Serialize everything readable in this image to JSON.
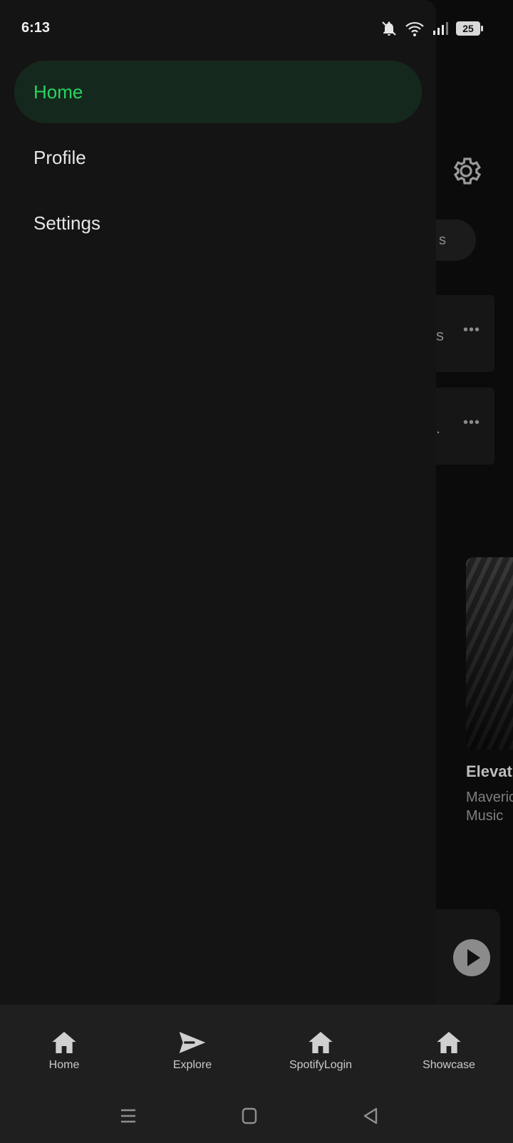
{
  "status_bar": {
    "time": "6:13",
    "battery": "25",
    "icons": [
      "bell-muted-icon",
      "wifi-icon",
      "signal-icon",
      "battery-icon"
    ]
  },
  "drawer": {
    "items": [
      {
        "label": "Home",
        "active": true
      },
      {
        "label": "Profile",
        "active": false
      },
      {
        "label": "Settings",
        "active": false
      }
    ]
  },
  "background": {
    "chip_partial_text": "s",
    "card1_partial_text": "s",
    "card2_partial_text": ".",
    "more_label": "•••",
    "album_title_partial": "Elevat",
    "album_artist_partial": "Maveric Music"
  },
  "bottom_nav": {
    "items": [
      {
        "label": "Home",
        "icon": "home-icon"
      },
      {
        "label": "Explore",
        "icon": "send-icon"
      },
      {
        "label": "SpotifyLogin",
        "icon": "home-icon"
      },
      {
        "label": "Showcase",
        "icon": "home-icon"
      }
    ]
  },
  "colors": {
    "accent": "#2ad45f",
    "active_bg": "#15281e",
    "drawer_bg": "#141414",
    "nav_bg": "#1f1f1f"
  }
}
